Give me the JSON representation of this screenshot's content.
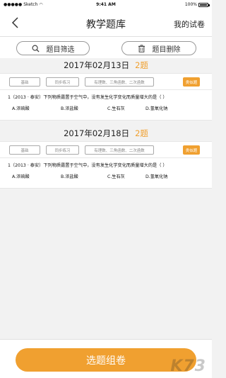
{
  "status_bar": {
    "carrier": "Sketch",
    "time": "9:41 AM",
    "battery": "100%"
  },
  "nav": {
    "title": "教学题库",
    "right_label": "我的试卷",
    "back_icon": "chevron-left-icon"
  },
  "toolbar": {
    "filter_label": "题目筛选",
    "filter_icon": "search-icon",
    "delete_label": "题目删除",
    "delete_icon": "trash-icon"
  },
  "groups": [
    {
      "date": "2017年02月13日",
      "count": "2题",
      "tags": [
        "基础",
        "同步练习",
        "有理数、三角函数、二次函数"
      ],
      "similar_label": "类似题",
      "question": "1（2013 · 泰安）下列物质露置于空气中，没有发生化学变化而质量增大的是（    ）",
      "options": [
        "A.浓硫酸",
        "B.浓盐酸",
        "C.生石灰",
        "D.氢氧化钠"
      ]
    },
    {
      "date": "2017年02月18日",
      "count": "2题",
      "tags": [
        "基础",
        "同步练习",
        "有理数、三角函数、二次函数"
      ],
      "similar_label": "类似题",
      "question": "1（2013 · 泰安）下列物质露置于空气中，没有发生化学变化而质量增大的是（    ）",
      "options": [
        "A.浓硫酸",
        "B.浓盐酸",
        "C.生石灰",
        "D.氢氧化钠"
      ]
    }
  ],
  "bottom": {
    "select_label": "选题组卷"
  },
  "watermark": "K73",
  "colors": {
    "accent": "#f0a030",
    "background": "#f2f2f2",
    "card": "#ffffff"
  }
}
